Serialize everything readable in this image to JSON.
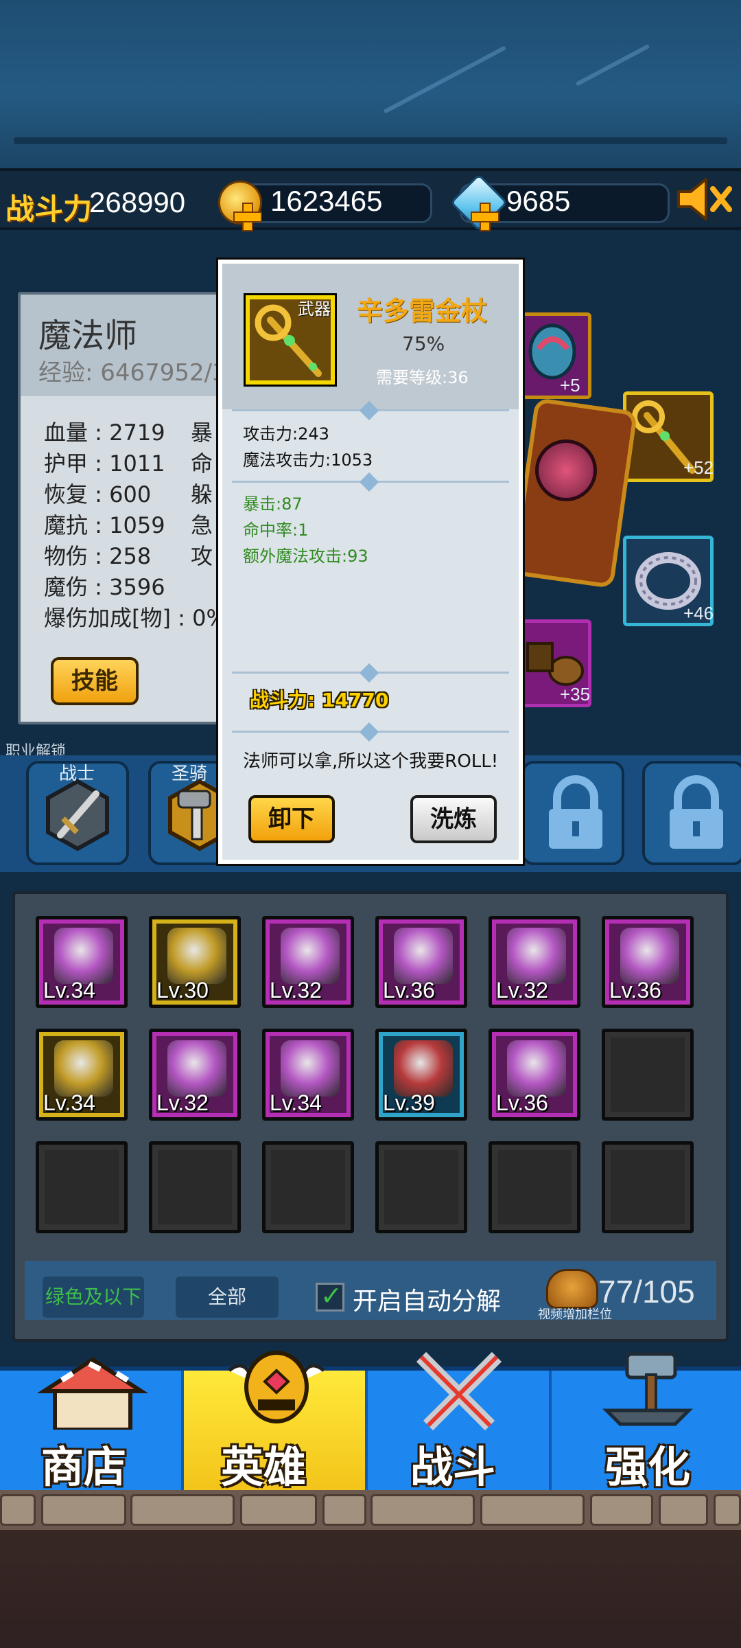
{
  "topbar": {
    "power_label": "战斗力",
    "power_value": "268990",
    "gold": "1623465",
    "diamonds": "9685",
    "icons": [
      "gold-coin-icon",
      "diamond-icon",
      "plus-icon",
      "mute-speaker-icon"
    ]
  },
  "hero": {
    "name": "魔法师",
    "exp": "经验: 6467952/3",
    "stats_left": [
      "血量 : 2719",
      "护甲 : 1011",
      "恢复 : 600",
      "魔抗 : 1059",
      "物伤 : 258",
      "魔伤 : 3596",
      "爆伤加成[物] : 0%"
    ],
    "stats_right": [
      "暴",
      "命",
      "躲",
      "急",
      "攻"
    ],
    "skill_button": "技能"
  },
  "equipment_side": {
    "bonuses": [
      "+5",
      "+52",
      "+46",
      "+35"
    ]
  },
  "classes": {
    "section_label": "职业解锁",
    "items": [
      {
        "name": "战士",
        "locked": false
      },
      {
        "name": "圣骑",
        "locked": false
      },
      {
        "name": "",
        "locked": true
      },
      {
        "name": "",
        "locked": true
      }
    ]
  },
  "popup": {
    "slot_tag": "武器",
    "item_name": "辛多雷金杖",
    "percent": "75%",
    "required_level": "需要等级:36",
    "base_stats": [
      "攻击力:243",
      "魔法攻击力:1053"
    ],
    "bonus_stats": [
      "暴击:87",
      "命中率:1",
      "额外魔法攻击:93"
    ],
    "power": "战斗力: 14770",
    "description": "法师可以拿,所以这个我要ROLL!",
    "unequip_button": "卸下",
    "refine_button": "洗炼",
    "colors": {
      "name": "#f2a812",
      "bonus": "#2f8a20",
      "frame": "#f5d800"
    }
  },
  "inventory": {
    "rows": [
      [
        {
          "level": "Lv.34",
          "rarity": "purple",
          "art": "gauntlets"
        },
        {
          "level": "Lv.30",
          "rarity": "gold",
          "art": "helm-blue"
        },
        {
          "level": "Lv.32",
          "rarity": "purple",
          "art": "armor-purple"
        },
        {
          "level": "Lv.36",
          "rarity": "purple",
          "art": "cross-gold"
        },
        {
          "level": "Lv.32",
          "rarity": "purple",
          "art": "armor-gold"
        },
        {
          "level": "Lv.36",
          "rarity": "purple",
          "art": "sword-shield"
        }
      ],
      [
        {
          "level": "Lv.34",
          "rarity": "gold",
          "art": "gloves-black"
        },
        {
          "level": "Lv.32",
          "rarity": "purple",
          "art": "armor-red"
        },
        {
          "level": "Lv.34",
          "rarity": "purple",
          "art": "helm-red"
        },
        {
          "level": "Lv.39",
          "rarity": "blue",
          "art": "ring-red"
        },
        {
          "level": "Lv.36",
          "rarity": "purple",
          "art": "orb-blue"
        },
        {
          "level": "",
          "rarity": "empty",
          "art": ""
        }
      ]
    ],
    "empty_row_count": 6,
    "filter_green": "绿色及以下",
    "filter_all": "全部",
    "auto_decompose": "开启自动分解",
    "bag_count": "77/105",
    "bag_hint": "视频增加栏位"
  },
  "nav": {
    "tabs": [
      {
        "label": "商店",
        "icon": "shop-icon",
        "active": false
      },
      {
        "label": "英雄",
        "icon": "hero-helmet-icon",
        "active": true
      },
      {
        "label": "战斗",
        "icon": "crossed-swords-icon",
        "active": false
      },
      {
        "label": "强化",
        "icon": "hammer-anvil-icon",
        "active": false
      }
    ]
  }
}
